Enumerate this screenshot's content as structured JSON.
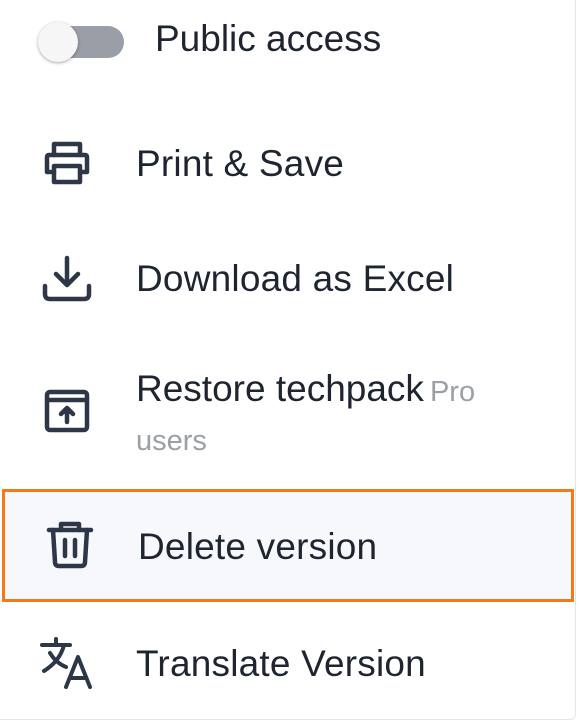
{
  "menu": {
    "public_access": {
      "label": "Public access",
      "enabled": false
    },
    "print_save": {
      "label": "Print & Save",
      "icon": "printer-icon"
    },
    "download_excel": {
      "label": "Download as Excel",
      "icon": "download-icon"
    },
    "restore_techpack": {
      "label": "Restore techpack",
      "badge": "Pro",
      "badge_sub": "users",
      "icon": "archive-restore-icon"
    },
    "delete_version": {
      "label": "Delete version",
      "icon": "trash-icon",
      "highlighted": true
    },
    "translate_version": {
      "label": "Translate Version",
      "icon": "translate-icon"
    }
  },
  "colors": {
    "text": "#1e2530",
    "muted": "#9aa0a6",
    "highlight_border": "#f27a1a",
    "highlight_bg": "#f6f8fb",
    "toggle_track": "#9a9ea6"
  }
}
